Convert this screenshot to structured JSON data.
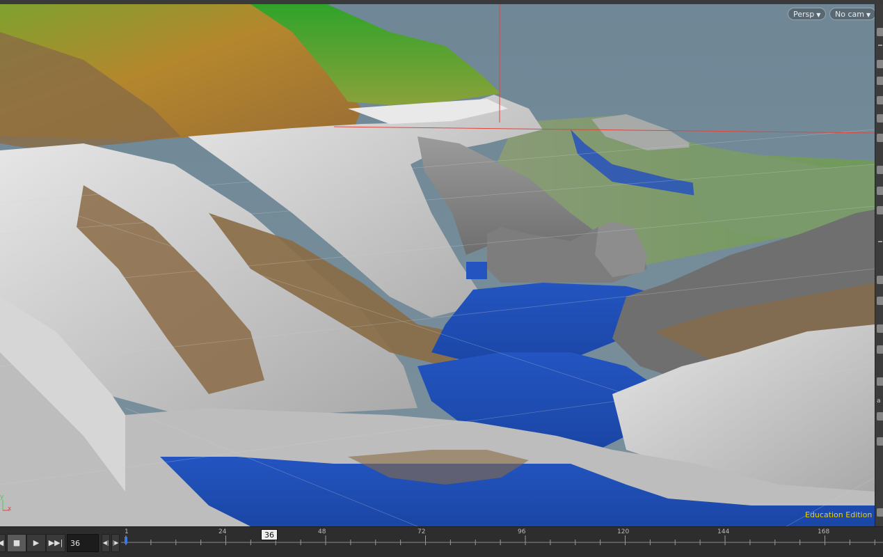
{
  "viewport": {
    "camera_view": "Persp",
    "camera_select": "No cam",
    "edition_label": "Education Edition",
    "axis_y": "y",
    "axis_x": "x"
  },
  "shelf": {
    "letter": "a"
  },
  "timeline": {
    "current_frame": "36",
    "cursor_label": "36",
    "start_label": "1",
    "tick_labels": [
      "24",
      "48",
      "72",
      "96",
      "120",
      "144",
      "168"
    ]
  },
  "colors": {
    "sky": "#6b8393",
    "snow": "#c9c9c9",
    "rock": "#8a8a8a",
    "dirt": "#8a6b45",
    "grass": "#6f9a5a",
    "high_green": "#3fa33a",
    "ochre": "#b4872d",
    "water": "#1e4fb3",
    "edition_text": "#f2d300",
    "axis_red": "#e0463e"
  }
}
